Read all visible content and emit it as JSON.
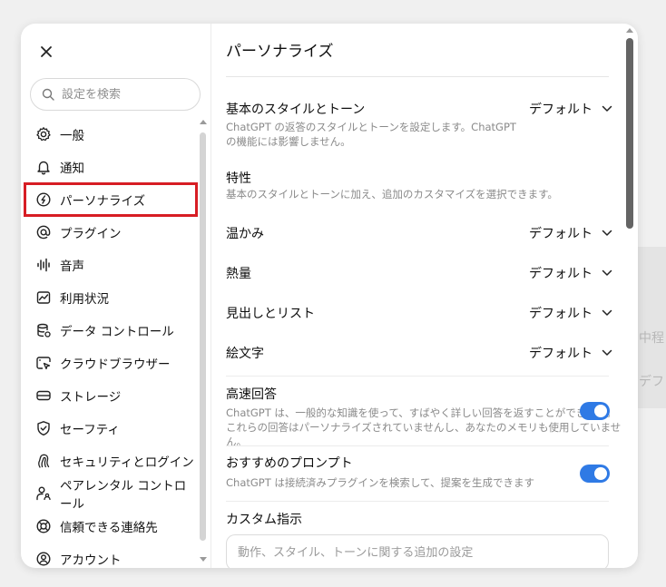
{
  "background": {
    "text1": "中程",
    "text2": "デフ"
  },
  "sidebar": {
    "search_placeholder": "設定を検索",
    "items": [
      {
        "label": "一般",
        "icon": "gear-icon"
      },
      {
        "label": "通知",
        "icon": "bell-icon"
      },
      {
        "label": "パーソナライズ",
        "icon": "personalize-icon",
        "active": true
      },
      {
        "label": "プラグイン",
        "icon": "at-icon"
      },
      {
        "label": "音声",
        "icon": "voice-icon"
      },
      {
        "label": "利用状況",
        "icon": "chart-icon"
      },
      {
        "label": "データ コントロール",
        "icon": "database-icon"
      },
      {
        "label": "クラウドブラウザー",
        "icon": "cloud-browser-icon"
      },
      {
        "label": "ストレージ",
        "icon": "storage-icon"
      },
      {
        "label": "セーフティ",
        "icon": "shield-icon"
      },
      {
        "label": "セキュリティとログイン",
        "icon": "security-icon"
      },
      {
        "label": "ペアレンタル コントロール",
        "icon": "parental-icon"
      },
      {
        "label": "信頼できる連絡先",
        "icon": "lifebuoy-icon"
      },
      {
        "label": "アカウント",
        "icon": "account-icon"
      }
    ]
  },
  "main": {
    "title": "パーソナライズ",
    "base_style": {
      "label": "基本のスタイルとトーン",
      "desc_line1": "ChatGPT の返答のスタイルとトーンを設定します。ChatGPT",
      "desc_line2": "の機能には影響しません。",
      "value": "デフォルト"
    },
    "traits": {
      "label": "特性",
      "desc": "基本のスタイルとトーンに加え、追加のカスタマイズを選択できます。"
    },
    "warmth": {
      "label": "温かみ",
      "value": "デフォルト"
    },
    "enthusiasm": {
      "label": "熱量",
      "value": "デフォルト"
    },
    "headings": {
      "label": "見出しとリスト",
      "value": "デフォルト"
    },
    "emoji": {
      "label": "絵文字",
      "value": "デフォルト"
    },
    "fast_answers": {
      "label": "高速回答",
      "desc_line1": "ChatGPT は、一般的な知識を使って、すばやく詳しい回答を返すことができます。",
      "desc_line2": "これらの回答はパーソナライズされていませんし、あなたのメモリも使用していません。",
      "enabled": true
    },
    "suggested_prompts": {
      "label": "おすすめのプロンプト",
      "desc": "ChatGPT は接続済みプラグインを検索して、提案を生成できます",
      "enabled": true
    },
    "custom_instructions": {
      "label": "カスタム指示",
      "placeholder": "動作、スタイル、トーンに関する追加の設定"
    }
  },
  "colors": {
    "accent": "#2f7ae5",
    "highlight": "#d71d24"
  }
}
